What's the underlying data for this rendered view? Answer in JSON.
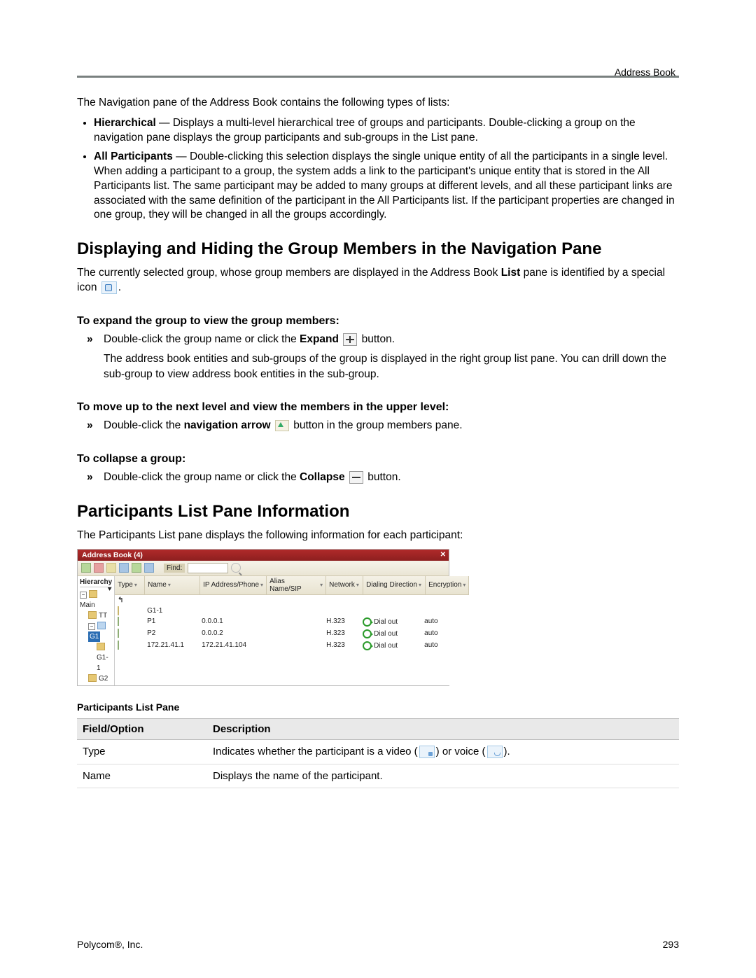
{
  "header": {
    "section": "Address Book"
  },
  "intro": "The Navigation pane of the Address Book contains the following types of lists:",
  "bullets": [
    {
      "term": "Hierarchical",
      "desc": " — Displays a multi-level hierarchical tree of groups and participants. Double-clicking a group on the navigation pane displays the group participants and sub-groups in the List pane."
    },
    {
      "term": "All Participants",
      "desc": " — Double-clicking this selection displays the single unique entity of all the participants in a single level. When adding a participant to a group, the system adds a link to the participant's unique entity that is stored in the All Participants list. The same participant may be added to many groups at different levels, and all these participant links are associated with the same definition of the participant in the All Participants list. If the participant properties are changed in one group, they will be changed in all the groups accordingly."
    }
  ],
  "h1": "Displaying and Hiding the Group Members in the Navigation Pane",
  "p1_a": "The currently selected group, whose group members are displayed in the Address Book ",
  "p1_b": "List",
  "p1_c": " pane is identified by a special icon ",
  "p1_d": ".",
  "sub1": "To expand the group to view the group members:",
  "s1_a": "Double-click the group name or click the ",
  "s1_b": "Expand",
  "s1_c": " button.",
  "s1_after": "The address book entities and sub-groups of the group is displayed in the right group list pane. You can drill down the sub-group to view address book entities in the sub-group.",
  "sub2": "To move up to the next level and view the members in the upper level:",
  "s2_a": "Double-click the ",
  "s2_b": "navigation arrow",
  "s2_c": " button in the group members pane.",
  "sub3": "To collapse a group:",
  "s3_a": "Double-click the group name or click the ",
  "s3_b": "Collapse",
  "s3_c": " button.",
  "h2": "Participants List Pane Information",
  "p2": "The Participants List pane displays the following information for each participant:",
  "shot": {
    "title": "Address Book (4)",
    "find": "Find:",
    "nav_header": "Hierarchy",
    "tree": {
      "main": "Main",
      "tt": "TT",
      "g1": "G1",
      "g11": "G1-1",
      "g2": "G2"
    },
    "cols": {
      "type": "Type",
      "name": "Name",
      "ip": "IP Address/Phone",
      "alias": "Alias Name/SIP",
      "net": "Network",
      "dial": "Dialing Direction",
      "enc": "Encryption"
    },
    "rows": [
      {
        "type": "up",
        "name": "",
        "ip": "",
        "alias": "",
        "net": "",
        "dial_icon": false,
        "dial": "",
        "enc": ""
      },
      {
        "type": "grp",
        "name": "G1-1",
        "ip": "",
        "alias": "",
        "net": "",
        "dial_icon": false,
        "dial": "",
        "enc": ""
      },
      {
        "type": "p",
        "name": "P1",
        "ip": "0.0.0.1",
        "alias": "",
        "net": "H.323",
        "dial_icon": true,
        "dial": "Dial out",
        "enc": "auto"
      },
      {
        "type": "p",
        "name": "P2",
        "ip": "0.0.0.2",
        "alias": "",
        "net": "H.323",
        "dial_icon": true,
        "dial": "Dial out",
        "enc": "auto"
      },
      {
        "type": "p",
        "name": "172.21.41.1",
        "ip": "172.21.41.104",
        "alias": "",
        "net": "H.323",
        "dial_icon": true,
        "dial": "Dial out",
        "enc": "auto"
      }
    ]
  },
  "plp_title": "Participants List Pane",
  "plp_h1": "Field/Option",
  "plp_h2": "Description",
  "plp_rows": {
    "type_field": "Type",
    "type_desc_a": "Indicates whether the participant is a video (",
    "type_desc_b": ") or voice (",
    "type_desc_c": ").",
    "name_field": "Name",
    "name_desc": "Displays the name of the participant."
  },
  "footer": {
    "left": "Polycom®, Inc.",
    "right": "293"
  }
}
